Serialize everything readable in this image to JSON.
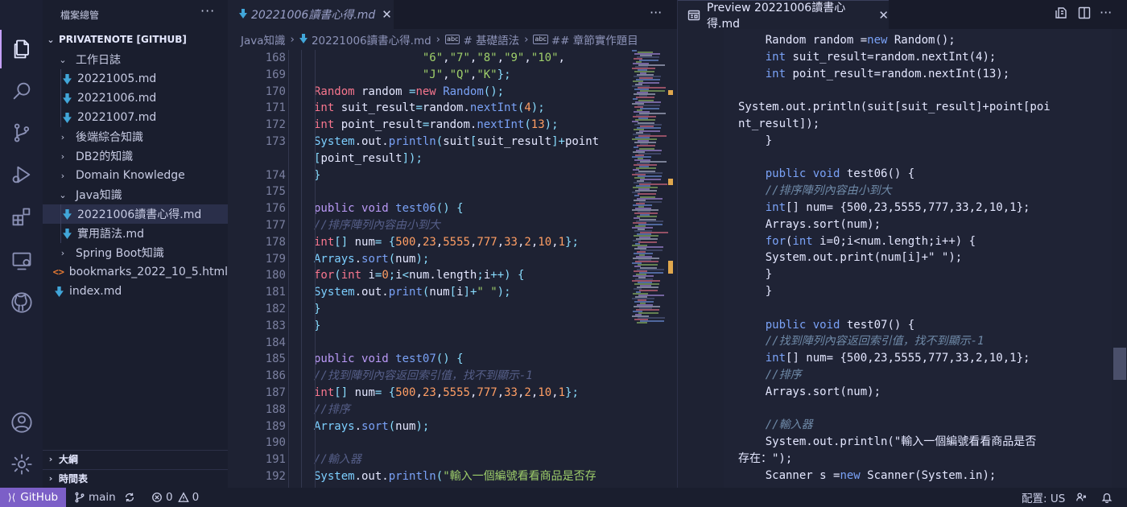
{
  "colors": {
    "accent": "#7c5fc7",
    "md_icon": "#41a6d9",
    "html_icon": "#e37933",
    "scroll_marker": "#e0a74d"
  },
  "activity_bar": {
    "items": [
      "explorer-icon",
      "search-icon",
      "source-control-icon",
      "run-debug-icon",
      "extensions-icon",
      "remote-explorer-icon",
      "github-icon",
      "account-icon",
      "settings-gear-icon"
    ]
  },
  "sidebar": {
    "title": "檔案總管",
    "more": "···",
    "workspace": "PRIVATENOTE [GITHUB]",
    "tree": [
      {
        "label": "工作日誌",
        "kind": "folder-open",
        "depth": 1
      },
      {
        "label": "20221005.md",
        "kind": "md",
        "depth": 2
      },
      {
        "label": "20221006.md",
        "kind": "md",
        "depth": 2
      },
      {
        "label": "20221007.md",
        "kind": "md",
        "depth": 2
      },
      {
        "label": "後端綜合知識",
        "kind": "folder",
        "depth": 1
      },
      {
        "label": "DB2的知識",
        "kind": "folder",
        "depth": 1
      },
      {
        "label": "Domain Knowledge",
        "kind": "folder",
        "depth": 1
      },
      {
        "label": "Java知識",
        "kind": "folder-open",
        "depth": 1
      },
      {
        "label": "20221006讀書心得.md",
        "kind": "md",
        "depth": 2,
        "selected": true
      },
      {
        "label": "實用語法.md",
        "kind": "md",
        "depth": 2
      },
      {
        "label": "Spring Boot知識",
        "kind": "folder",
        "depth": 1
      },
      {
        "label": "bookmarks_2022_10_5.html",
        "kind": "html",
        "depth": 1
      },
      {
        "label": "index.md",
        "kind": "md",
        "depth": 1
      }
    ],
    "outline": "大綱",
    "timeline": "時間表"
  },
  "editor": {
    "tab_label": "20221006讀書心得.md",
    "close": "✕",
    "more": "···",
    "breadcrumbs": [
      "Java知識",
      "20221006讀書心得.md",
      "# 基礎語法",
      "## 章節實作題目"
    ],
    "line_numbers": [
      "168",
      "169",
      "170",
      "171",
      "172",
      "173",
      "",
      "174",
      "175",
      "176",
      "177",
      "178",
      "179",
      "180",
      "181",
      "182",
      "183",
      "184",
      "185",
      "186",
      "187",
      "188",
      "189",
      "190",
      "191",
      "192"
    ],
    "code_lines": [
      "                \"6\",\"7\",\"8\",\"9\",\"10\",",
      "                \"J\",\"Q\",\"K\"};",
      "Random random =new Random();",
      "int suit_result=random.nextInt(4);",
      "int point_result=random.nextInt(13);",
      "System.out.println(suit[suit_result]+point",
      "[point_result]);",
      "}",
      "",
      "public void test06() {",
      "//排序陣列內容由小到大",
      "int[] num= {500,23,5555,777,33,2,10,1};",
      "Arrays.sort(num);",
      "for(int i=0;i<num.length;i++) {",
      "System.out.print(num[i]+\" \");",
      "}",
      "}",
      "",
      "public void test07() {",
      "//找到陣列內容返回索引值，找不到顯示-1",
      "int[] num= {500,23,5555,777,33,2,10,1};",
      "//排序",
      "Arrays.sort(num);",
      "",
      "//輸入器",
      "System.out.println(\"輸入一個編號看看商品是否存"
    ]
  },
  "preview": {
    "tab_label": "Preview 20221006讀書心得.md",
    "close": "✕",
    "lines": [
      "    Random random =new Random();",
      "    int suit_result=random.nextInt(4);",
      "    int point_result=random.nextInt(13);",
      "",
      "System.out.println(suit[suit_result]+point[poi",
      "nt_result]);",
      "    }",
      "",
      "    public void test06() {",
      "    //排序陣列內容由小到大",
      "    int[] num= {500,23,5555,777,33,2,10,1};",
      "    Arrays.sort(num);",
      "    for(int i=0;i<num.length;i++) {",
      "    System.out.print(num[i]+\" \");",
      "    }",
      "    }",
      "",
      "    public void test07() {",
      "    //找到陣列內容返回索引值，找不到顯示-1",
      "    int[] num= {500,23,5555,777,33,2,10,1};",
      "    //排序",
      "    Arrays.sort(num);",
      "",
      "    //輸入器",
      "    System.out.println(\"輸入一個編號看看商品是否",
      "存在：\");",
      "    Scanner s =new Scanner(System.in);"
    ]
  },
  "statusbar": {
    "remote": "GitHub",
    "branch": "main",
    "errors": "0",
    "warnings": "0",
    "layout": "配置: US"
  }
}
